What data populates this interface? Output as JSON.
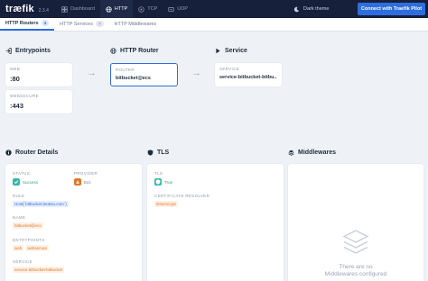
{
  "topbar": {
    "logo": "træfik",
    "version": "2.3.4",
    "nav": [
      {
        "label": "Dashboard",
        "icon": "dashboard-icon"
      },
      {
        "label": "HTTP",
        "icon": "globe-icon"
      },
      {
        "label": "TCP",
        "icon": "tcp-icon"
      },
      {
        "label": "UDP",
        "icon": "udp-icon"
      }
    ],
    "theme_label": "Dark theme",
    "connect_label": "Connect with Traefik Pilot"
  },
  "subnav": {
    "tabs": [
      {
        "label": "HTTP Routers",
        "count": "4"
      },
      {
        "label": "HTTP Services",
        "count": "7"
      },
      {
        "label": "HTTP Middlewares",
        "count": ""
      }
    ]
  },
  "flow": {
    "entrypoints_title": "Entrypoints",
    "router_title": "HTTP Router",
    "service_title": "Service",
    "entrypoints": [
      {
        "label": "WEB",
        "value": ":80"
      },
      {
        "label": "WEBSECURE",
        "value": ":443"
      }
    ],
    "router": {
      "label": "ROUTER",
      "value": "bitbucket@ecs"
    },
    "service": {
      "label": "SERVICE",
      "value": "service-bitbucket-bitbu..."
    }
  },
  "details": {
    "title": "Router Details",
    "status_label": "STATUS",
    "status_value": "Success",
    "provider_label": "PROVIDER",
    "provider_value": "Ecs",
    "rule_label": "RULE",
    "rule_value": "Host(`bitbucket.beatsu.com`)",
    "name_label": "NAME",
    "name_value": "bitbucket@ecs",
    "entrypoints_label": "ENTRYPOINTS",
    "entrypoints_values": [
      "web",
      "websecure"
    ],
    "service_label": "SERVICE",
    "service_value": "service-bitbucket-bitbucket"
  },
  "tls": {
    "title": "TLS",
    "tls_label": "TLS",
    "tls_value": "True",
    "resolver_label": "CERTIFICATE RESOLVER",
    "resolver_value": "letsencrypt"
  },
  "middlewares": {
    "title": "Middlewares",
    "empty_line1": "There are no",
    "empty_line2": "Middlewares configured"
  }
}
